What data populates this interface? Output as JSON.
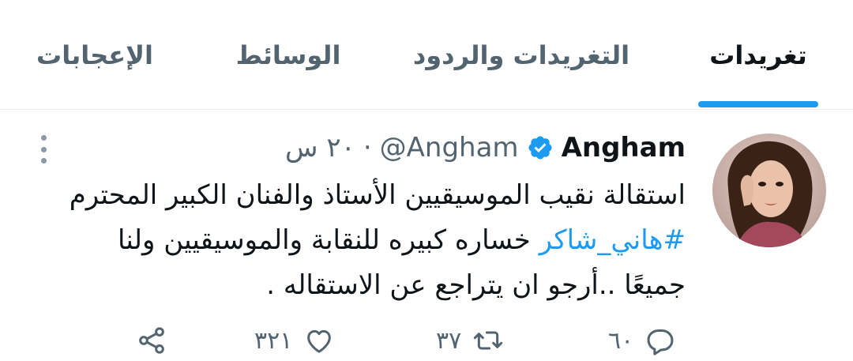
{
  "tabs": {
    "tweets": "تغريدات",
    "tweets_replies": "التغريدات والردود",
    "media": "الوسائط",
    "likes": "الإعجابات"
  },
  "tweet": {
    "name": "Angham",
    "handle": "@Angham",
    "time": "٢٠ س",
    "text_line1": "استقالة نقيب الموسيقيين الأستاذ والفنان الكبير  المحترم",
    "hashtag": "#هاني_شاكر",
    "text_line2_rest": "خساره كبيره للنقابة والموسيقيين ولنا",
    "text_line3": "جميعًا ..أرجو ان يتراجع عن الاستقاله .",
    "replies": "٦٠",
    "retweets": "٣٧",
    "likes": "٣٢١"
  },
  "colors": {
    "accent": "#1d9bf0",
    "muted": "#536471",
    "text": "#0f1419"
  },
  "icons": [
    "more-vertical-icon",
    "verified-badge-icon",
    "reply-icon",
    "retweet-icon",
    "like-icon",
    "share-icon"
  ]
}
